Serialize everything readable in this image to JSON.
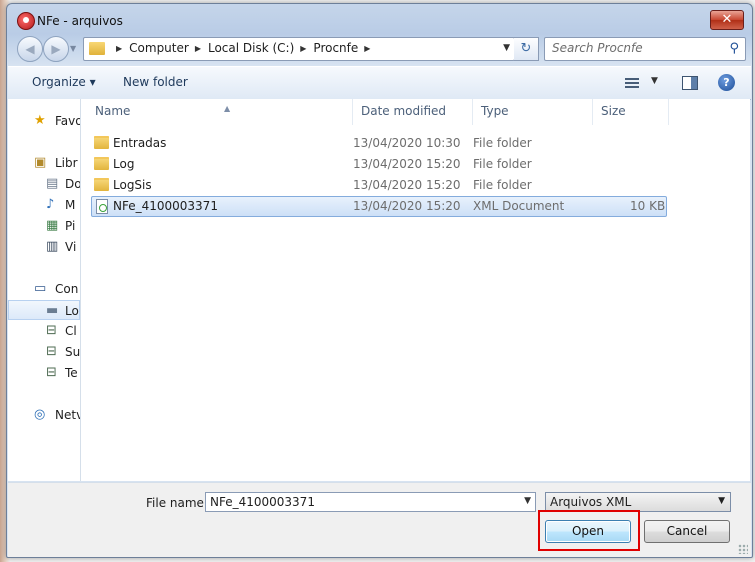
{
  "window": {
    "title": "NFe - arquivos",
    "close_glyph": "✕"
  },
  "nav": {
    "back_glyph": "◀",
    "forward_glyph": "▶",
    "recent_glyph": "▼",
    "breadcrumb": [
      "Computer",
      "Local Disk (C:)",
      "Procnfe"
    ],
    "breadcrumb_sep": "▶",
    "dropdown_glyph": "▼",
    "refresh_glyph": "↻",
    "search_placeholder": "Search Procnfe",
    "search_glyph": "⚲"
  },
  "toolbar": {
    "organize_label": "Organize ▾",
    "new_folder_label": "New folder",
    "view_drop_glyph": "▼",
    "help_glyph": "?"
  },
  "navpane": {
    "items": [
      {
        "label": "Favo",
        "icon": "★"
      },
      {
        "label": "Libr",
        "icon": "▣"
      },
      {
        "label": "Do",
        "icon": "▤"
      },
      {
        "label": "M",
        "icon": "♪"
      },
      {
        "label": "Pi",
        "icon": "▦"
      },
      {
        "label": "Vi",
        "icon": "▥"
      },
      {
        "label": "Con",
        "icon": "▭"
      },
      {
        "label": "Lo",
        "icon": "▬"
      },
      {
        "label": "Cl",
        "icon": "⊟"
      },
      {
        "label": "Su",
        "icon": "⊟"
      },
      {
        "label": "Te",
        "icon": "⊟"
      },
      {
        "label": "Netv",
        "icon": "◎"
      }
    ]
  },
  "files": {
    "columns": [
      "Name",
      "Date modified",
      "Type",
      "Size"
    ],
    "sort_glyph": "▲",
    "rows": [
      {
        "name": "Entradas",
        "date": "13/04/2020 10:30",
        "type": "File folder",
        "size": ""
      },
      {
        "name": "Log",
        "date": "13/04/2020 15:20",
        "type": "File folder",
        "size": ""
      },
      {
        "name": "LogSis",
        "date": "13/04/2020 15:20",
        "type": "File folder",
        "size": ""
      },
      {
        "name": "NFe_4100003371",
        "date": "13/04/2020 15:20",
        "type": "XML Document",
        "size": "10 KB"
      }
    ]
  },
  "bottom": {
    "file_name_label": "File name:",
    "file_name_value": "NFe_4100003371",
    "file_type_value": "Arquivos XML",
    "dropdown_glyph": "▼",
    "open_label": "Open",
    "cancel_label": "Cancel"
  }
}
